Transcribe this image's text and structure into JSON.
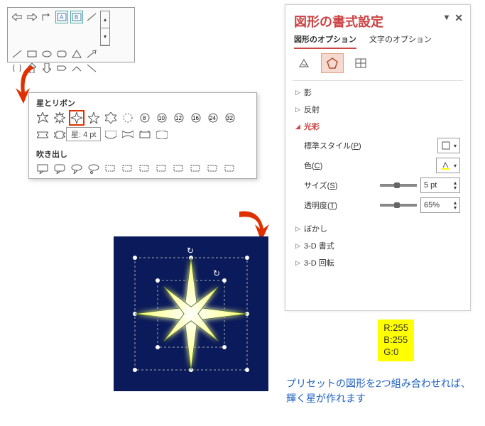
{
  "shapeMenu": {
    "sect1": "星とリボン",
    "tooltip": "星: 4 pt",
    "sect2": "吹き出し"
  },
  "pane": {
    "title": "図形の書式設定",
    "tab1": "図形のオプション",
    "tab2": "文字のオプション",
    "shadow": "影",
    "reflection": "反射",
    "glow": "光彩",
    "preset": "標準スタイル(",
    "presetU": "P",
    "presetEnd": ")",
    "color": "色(",
    "colorU": "C",
    "colorEnd": ")",
    "size": "サイズ(",
    "sizeU": "S",
    "sizeEnd": ")",
    "transparency": "透明度(",
    "transU": "T",
    "transEnd": ")",
    "sizeVal": "5 pt",
    "transVal": "65%",
    "blur": "ぼかし",
    "fmt3d": "3-D 書式",
    "rot3d": "3-D 回転"
  },
  "note": {
    "r": "R:255",
    "b": "B:255",
    "g": "G:0"
  },
  "caption": "プリセットの図形を2つ組み合わせれば、輝く星が作れます"
}
